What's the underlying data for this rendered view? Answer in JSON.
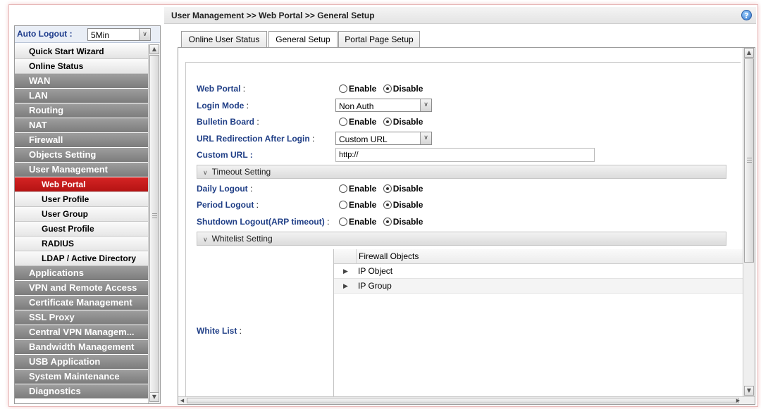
{
  "sidebar": {
    "auto_logout_label": "Auto Logout :",
    "auto_logout_value": "5Min",
    "items": [
      {
        "label": "Quick Start Wizard",
        "style": "light"
      },
      {
        "label": "Online Status",
        "style": "light"
      },
      {
        "label": "WAN",
        "style": "dark"
      },
      {
        "label": "LAN",
        "style": "dark"
      },
      {
        "label": "Routing",
        "style": "dark"
      },
      {
        "label": "NAT",
        "style": "dark"
      },
      {
        "label": "Firewall",
        "style": "dark"
      },
      {
        "label": "Objects Setting",
        "style": "dark"
      },
      {
        "label": "User Management",
        "style": "dark"
      },
      {
        "label": "Web Portal",
        "style": "sub-active"
      },
      {
        "label": "User Profile",
        "style": "sub"
      },
      {
        "label": "User Group",
        "style": "sub"
      },
      {
        "label": "Guest Profile",
        "style": "sub"
      },
      {
        "label": "RADIUS",
        "style": "sub"
      },
      {
        "label": "LDAP / Active Directory",
        "style": "sub"
      },
      {
        "label": "Applications",
        "style": "dark"
      },
      {
        "label": "VPN and Remote Access",
        "style": "dark"
      },
      {
        "label": "Certificate Management",
        "style": "dark"
      },
      {
        "label": "SSL Proxy",
        "style": "dark"
      },
      {
        "label": "Central VPN Managem...",
        "style": "dark"
      },
      {
        "label": "Bandwidth Management",
        "style": "dark"
      },
      {
        "label": "USB Application",
        "style": "dark"
      },
      {
        "label": "System Maintenance",
        "style": "dark"
      },
      {
        "label": "Diagnostics",
        "style": "dark"
      }
    ]
  },
  "header": {
    "breadcrumb": "User Management >> Web Portal >> General Setup",
    "help_icon": "question-icon"
  },
  "tabs": [
    {
      "label": "Online User Status",
      "active": false
    },
    {
      "label": "General Setup",
      "active": true
    },
    {
      "label": "Portal Page Setup",
      "active": false
    }
  ],
  "form": {
    "enable_label": "Enable",
    "disable_label": "Disable",
    "web_portal": {
      "label": "Web Portal",
      "colon": " :",
      "value": "Disable"
    },
    "login_mode": {
      "label": "Login Mode",
      "colon": " :",
      "value": "Non Auth"
    },
    "bulletin_board": {
      "label": "Bulletin Board",
      "colon": " :",
      "value": "Disable"
    },
    "url_redirection": {
      "label": "URL Redirection After Login",
      "colon": " :",
      "value": "Custom URL"
    },
    "custom_url": {
      "label": "Custom URL :",
      "value": "http://"
    },
    "timeout_section": "Timeout Setting",
    "daily_logout": {
      "label": "Daily Logout",
      "colon": " :",
      "value": "Disable"
    },
    "period_logout": {
      "label": "Period Logout",
      "colon": " :",
      "value": "Disable"
    },
    "shutdown_logout": {
      "label": "Shutdown Logout(ARP timeout)",
      "colon": " :",
      "value": "Disable"
    },
    "whitelist_section": "Whitelist Setting",
    "white_list": {
      "label": "White List",
      "colon": " :"
    },
    "firewall_objects": {
      "header": "Firewall Objects",
      "rows": [
        "IP Object",
        "IP Group"
      ]
    }
  },
  "colors": {
    "active_menu": "#c91b1b",
    "label_blue": "#1f3e86"
  }
}
